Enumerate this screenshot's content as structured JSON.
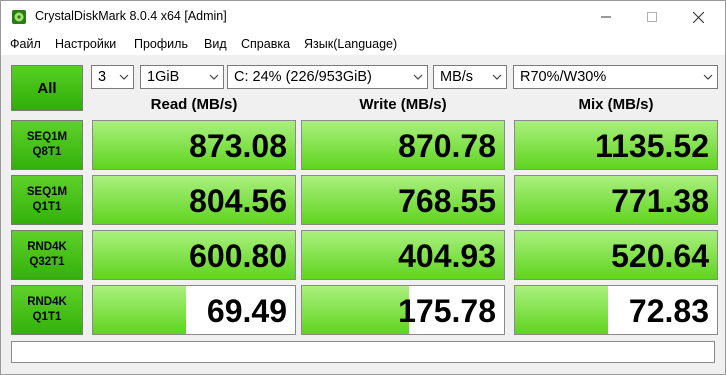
{
  "window": {
    "title": "CrystalDiskMark 8.0.4 x64 [Admin]"
  },
  "menu": [
    "Файл",
    "Настройки",
    "Профиль",
    "Вид",
    "Справка",
    "Язык(Language)"
  ],
  "controls": {
    "all_label": "All",
    "count": "3",
    "size": "1GiB",
    "drive": "C: 24% (226/953GiB)",
    "unit": "MB/s",
    "mix": "R70%/W30%"
  },
  "columns": {
    "read": "Read (MB/s)",
    "write": "Write (MB/s)",
    "mix": "Mix (MB/s)"
  },
  "rows": [
    {
      "line1": "SEQ1M",
      "line2": "Q8T1",
      "read": "873.08",
      "write": "870.78",
      "mix": "1135.52",
      "read_fill": 1.0,
      "write_fill": 1.0,
      "mix_fill": 1.0
    },
    {
      "line1": "SEQ1M",
      "line2": "Q1T1",
      "read": "804.56",
      "write": "768.55",
      "mix": "771.38",
      "read_fill": 1.0,
      "write_fill": 1.0,
      "mix_fill": 1.0
    },
    {
      "line1": "RND4K",
      "line2": "Q32T1",
      "read": "600.80",
      "write": "404.93",
      "mix": "520.64",
      "read_fill": 1.0,
      "write_fill": 1.0,
      "mix_fill": 1.0
    },
    {
      "line1": "RND4K",
      "line2": "Q1T1",
      "read": "69.49",
      "write": "175.78",
      "mix": "72.83",
      "read_fill": 0.46,
      "write_fill": 0.53,
      "mix_fill": 0.46
    }
  ],
  "colors": {
    "accent_green": "#33b10b",
    "fill_light": "#aaf07e"
  }
}
